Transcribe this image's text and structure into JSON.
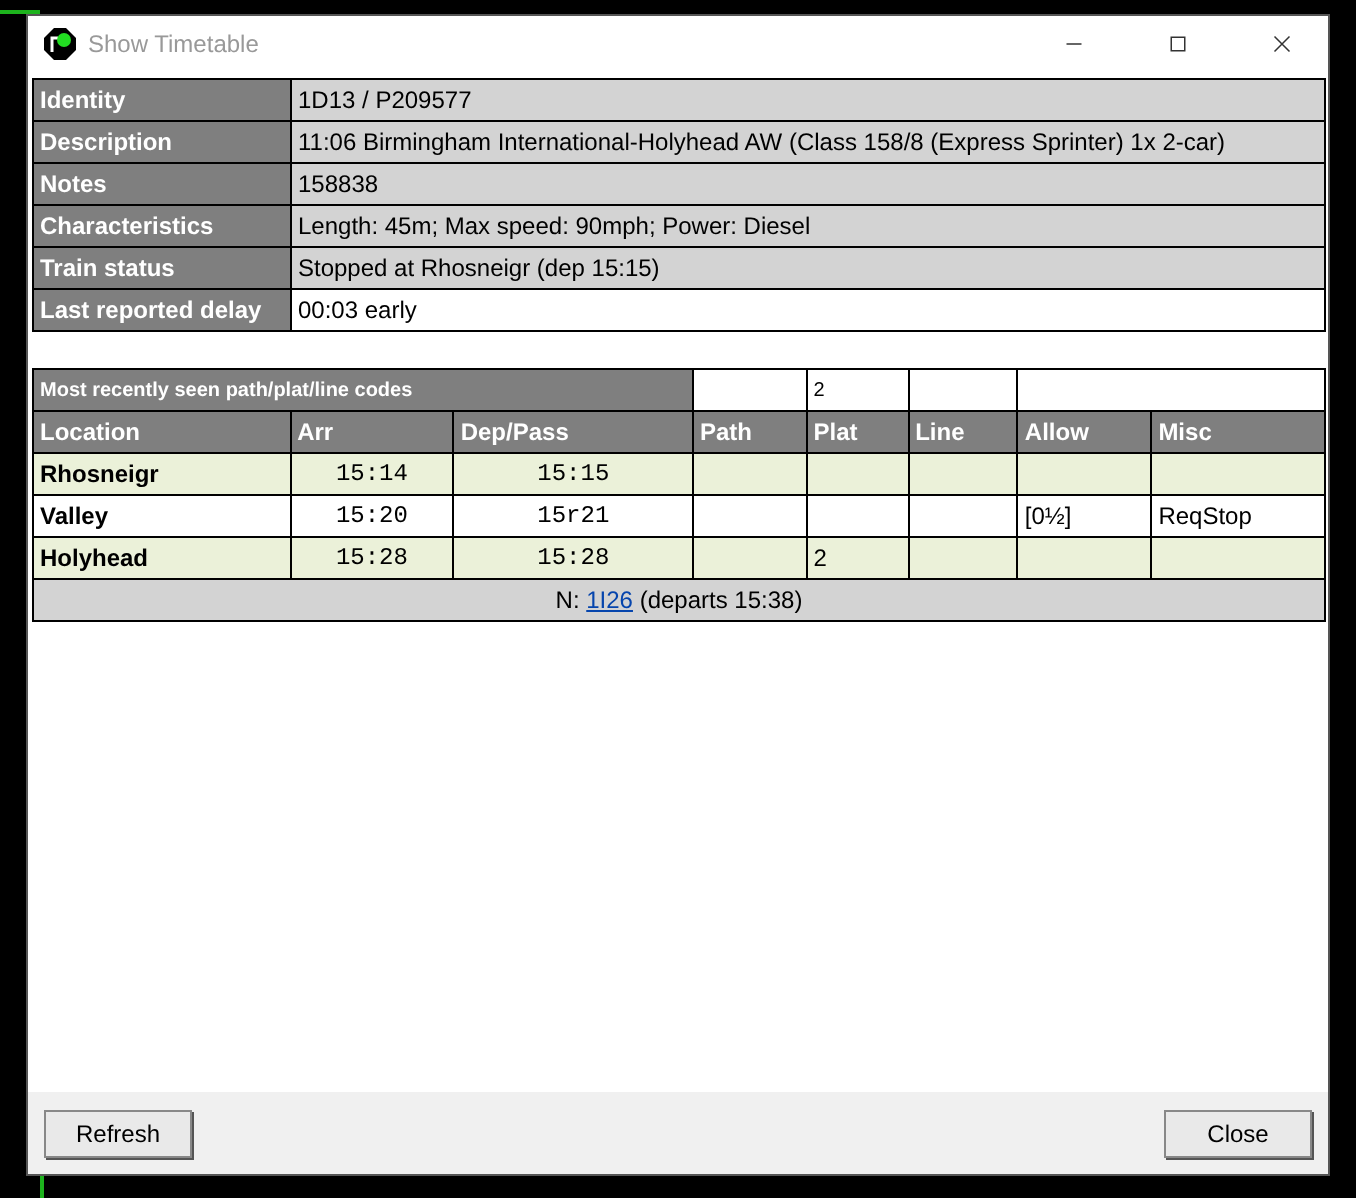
{
  "window": {
    "title": "Show Timetable"
  },
  "info": [
    {
      "label": "Identity",
      "value": "1D13 / P209577",
      "shaded": true
    },
    {
      "label": "Description",
      "value": "11:06 Birmingham International-Holyhead AW (Class 158/8 (Express Sprinter) 1x 2-car)",
      "shaded": true
    },
    {
      "label": "Notes",
      "value": "158838",
      "shaded": true
    },
    {
      "label": "Characteristics",
      "value": "Length: 45m; Max speed: 90mph; Power: Diesel",
      "shaded": true
    },
    {
      "label": "Train status",
      "value": "Stopped at Rhosneigr (dep 15:15)",
      "shaded": true
    },
    {
      "label": "Last reported delay",
      "value": "00:03 early",
      "shaded": false
    }
  ],
  "codes": {
    "label": "Most recently seen path/plat/line codes",
    "plat": "2"
  },
  "timetable": {
    "columns": [
      "Location",
      "Arr",
      "Dep/Pass",
      "Path",
      "Plat",
      "Line",
      "Allow",
      "Misc"
    ],
    "rows": [
      {
        "location": "Rhosneigr",
        "arr": "15:14",
        "dep": "15:15",
        "shaded": true
      },
      {
        "location": "Valley",
        "arr": "15:20",
        "dep": "15r21",
        "allow": "[0½]",
        "misc": "ReqStop",
        "shaded": false
      },
      {
        "location": "Holyhead",
        "arr": "15:28",
        "dep": "15:28",
        "plat": "2",
        "shaded": true
      }
    ],
    "next": {
      "prefix": "N:",
      "link": "1I26",
      "suffix": "(departs 15:38)"
    }
  },
  "buttons": {
    "refresh": "Refresh",
    "close": "Close"
  }
}
